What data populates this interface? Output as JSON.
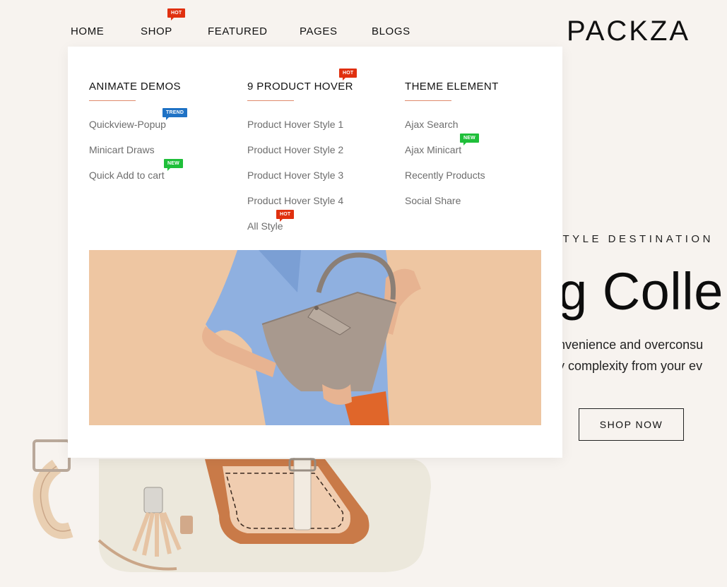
{
  "brand": {
    "logo": "PACKZA"
  },
  "nav": {
    "items": [
      {
        "label": "HOME"
      },
      {
        "label": "SHOP",
        "badge": "HOT"
      },
      {
        "label": "FEATURED"
      },
      {
        "label": "PAGES"
      },
      {
        "label": "BLOGS"
      }
    ]
  },
  "mega_menu": {
    "columns": [
      {
        "title": "ANIMATE DEMOS",
        "links": [
          {
            "label": "Quickview-Popup",
            "badge": "TREND"
          },
          {
            "label": "Minicart Draws"
          },
          {
            "label": "Quick Add to cart",
            "badge": "NEW"
          }
        ]
      },
      {
        "title": "9 PRODUCT HOVER",
        "title_badge": "HOT",
        "links": [
          {
            "label": "Product Hover Style 1"
          },
          {
            "label": "Product Hover Style 2"
          },
          {
            "label": "Product Hover Style 3"
          },
          {
            "label": "Product Hover Style 4"
          },
          {
            "label": "All Style",
            "badge": "HOT"
          }
        ]
      },
      {
        "title": "THEME ELEMENT",
        "links": [
          {
            "label": "Ajax Search"
          },
          {
            "label": "Ajax Minicart",
            "badge": "NEW"
          },
          {
            "label": "Recently Products"
          },
          {
            "label": "Social Share"
          }
        ]
      }
    ]
  },
  "hero": {
    "subtitle": "STYLE DESTINATION",
    "title": "g Colle",
    "text_lines": [
      "onvenience and overconsu",
      "ay complexity from your ev"
    ],
    "cta": "SHOP NOW"
  },
  "colors": {
    "background": "#f7f3ef",
    "hot": "#e0300f",
    "trend": "#1f72c5",
    "new": "#1fbf3a",
    "accent_rule": "#e08a6c"
  }
}
